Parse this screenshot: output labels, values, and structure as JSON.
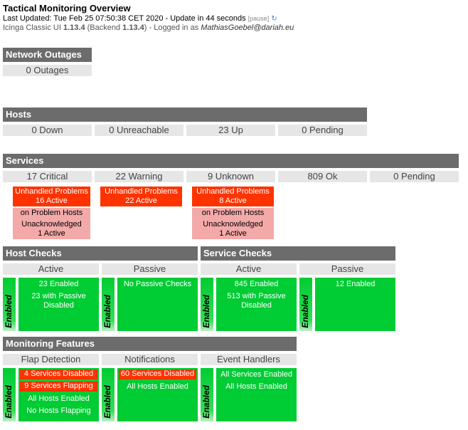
{
  "header": {
    "title": "Tactical Monitoring Overview",
    "last_updated": "Last Updated: Tue Feb 25 07:50:38 CET 2020 - Update in 44 seconds",
    "pause": "[pause]",
    "version_prefix": "Icinga Classic UI ",
    "version": "1.13.4",
    "backend_prefix": " (Backend ",
    "backend_version": "1.13.4",
    "logged_in_prefix": ") - Logged in as ",
    "user": "MathiasGoebel@dariah.eu"
  },
  "network_outages": {
    "title": "Network Outages",
    "value": "0 Outages"
  },
  "hosts": {
    "title": "Hosts",
    "cells": [
      "0 Down",
      "0 Unreachable",
      "23 Up",
      "0 Pending"
    ]
  },
  "services": {
    "title": "Services",
    "cells": [
      "17 Critical",
      "22 Warning",
      "9 Unknown",
      "809 Ok",
      "0 Pending"
    ],
    "critical": {
      "unhandled_label": "Unhandled Problems",
      "unhandled_value": "16 Active",
      "on_problem_hosts": "on Problem Hosts",
      "unack_label": "Unacknowledged",
      "unack_value": "1 Active"
    },
    "warning": {
      "unhandled_label": "Unhandled Problems",
      "unhandled_value": "22 Active"
    },
    "unknown": {
      "unhandled_label": "Unhandled Problems",
      "unhandled_value": "8 Active",
      "on_problem_hosts": "on Problem Hosts",
      "unack_label": "Unacknowledged",
      "unack_value": "1 Active"
    }
  },
  "host_checks": {
    "title": "Host Checks",
    "active_label": "Active",
    "passive_label": "Passive",
    "enabled_label": "Enabled",
    "active_enabled": "23 Enabled",
    "active_passive": "23 with Passive",
    "active_disabled": "Disabled",
    "passive_text": "No Passive Checks"
  },
  "service_checks": {
    "title": "Service Checks",
    "active_label": "Active",
    "passive_label": "Passive",
    "enabled_label": "Enabled",
    "active_enabled": "845 Enabled",
    "active_passive": "513 with Passive",
    "active_disabled": "Disabled",
    "passive_enabled": "12 Enabled"
  },
  "monitoring_features": {
    "title": "Monitoring Features",
    "enabled_label": "Enabled",
    "flap": {
      "label": "Flap Detection",
      "services_disabled": "4 Services Disabled",
      "services_flapping": "9 Services Flapping",
      "hosts_enabled": "All Hosts Enabled",
      "hosts_flapping": "No Hosts Flapping"
    },
    "notifications": {
      "label": "Notifications",
      "services_disabled": "60 Services Disabled",
      "hosts_enabled": "All Hosts Enabled"
    },
    "event_handlers": {
      "label": "Event Handlers",
      "services_enabled": "All Services Enabled",
      "hosts_enabled": "All Hosts Enabled"
    }
  },
  "colors": {
    "section_bar": "#6c6c6c",
    "critical": "#ff3300",
    "ok": "#00cc33",
    "unacknowledged": "#f4a9a9",
    "cell_bg": "#e6e6e6"
  }
}
